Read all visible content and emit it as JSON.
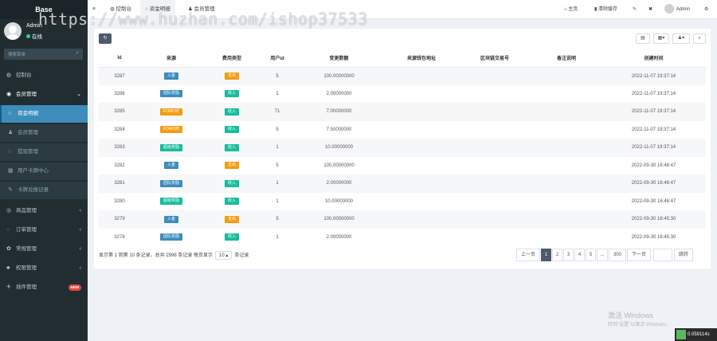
{
  "sidebar": {
    "brand": "Base",
    "user": {
      "name": "Admin",
      "status": "在线"
    },
    "search_placeholder": "搜索菜单",
    "items": [
      {
        "label": "控制台",
        "icon": "dashboard-icon",
        "type": "top"
      },
      {
        "label": "会员管理",
        "icon": "user-circle-icon",
        "type": "open",
        "arrow": "⌄"
      },
      {
        "label": "资金明细",
        "icon": "circle-icon",
        "type": "active"
      },
      {
        "label": "会员管理",
        "icon": "user-icon",
        "type": "sub"
      },
      {
        "label": "提现管理",
        "icon": "circle-icon",
        "type": "sub"
      },
      {
        "label": "用户卡牌中心",
        "icon": "table-icon",
        "type": "sub"
      },
      {
        "label": "卡牌兑换记录",
        "icon": "wrench-icon",
        "type": "sub"
      },
      {
        "label": "商品管理",
        "icon": "product-icon",
        "type": "top",
        "arrow": "‹"
      },
      {
        "label": "订单管理",
        "icon": "order-icon",
        "type": "top",
        "arrow": "‹"
      },
      {
        "label": "常规管理",
        "icon": "gear-icon",
        "type": "top",
        "arrow": "‹"
      },
      {
        "label": "权限管理",
        "icon": "group-icon",
        "type": "top",
        "arrow": "‹"
      },
      {
        "label": "插件管理",
        "icon": "rocket-icon",
        "type": "top",
        "badge": "NEW"
      }
    ]
  },
  "topbar": {
    "menu_icon": "≡",
    "tabs": [
      {
        "label": "控制台",
        "icon": "dashboard-icon"
      },
      {
        "label": "资金明细",
        "icon": "circle-icon"
      },
      {
        "label": "会员管理",
        "icon": "user-icon"
      }
    ],
    "home": "主页",
    "clear_cache": "清除缓存",
    "admin": "Admin"
  },
  "table": {
    "columns": [
      "Id",
      "来源",
      "费用类型",
      "用户id",
      "变更数额",
      "来源钱包地址",
      "区块链交易号",
      "备注说明",
      "创建时间"
    ],
    "rows": [
      [
        "3287",
        "入金",
        "支出",
        "5",
        "100.00000000",
        "",
        "",
        "",
        "2022-11-07 19:37:14"
      ],
      [
        "3286",
        "团队奖励",
        "收入",
        "1",
        "2.00000000",
        "",
        "",
        "",
        "2022-11-07 19:37:14"
      ],
      [
        "3285",
        "FOMO奖",
        "收入",
        "71",
        "7.00000000",
        "",
        "",
        "",
        "2022-11-07 19:37:14"
      ],
      [
        "3284",
        "FOMO奖",
        "收入",
        "5",
        "7.50000000",
        "",
        "",
        "",
        "2022-11-07 19:37:14"
      ],
      [
        "3283",
        "超级奖励",
        "收入",
        "1",
        "10.00000000",
        "",
        "",
        "",
        "2022-11-07 19:37:14"
      ],
      [
        "3282",
        "入金",
        "支出",
        "5",
        "100.00000000",
        "",
        "",
        "",
        "2022-09-30 16:46:47"
      ],
      [
        "3281",
        "团队奖励",
        "收入",
        "1",
        "2.00000000",
        "",
        "",
        "",
        "2022-09-30 16:46:47"
      ],
      [
        "3280",
        "超级奖励",
        "收入",
        "1",
        "10.00000000",
        "",
        "",
        "",
        "2022-09-30 16:46:47"
      ],
      [
        "3279",
        "入金",
        "支出",
        "5",
        "100.00000000",
        "",
        "",
        "",
        "2022-09-30 16:45:30"
      ],
      [
        "3278",
        "团队奖励",
        "收入",
        "1",
        "2.00000000",
        "",
        "",
        "",
        "2022-09-30 16:45:30"
      ]
    ]
  },
  "badge_colors": {
    "入金": "#3c8dbc",
    "团队奖励": "#3c8dbc",
    "FOMO奖": "#f39c12",
    "超级奖励": "#18bc9c",
    "支出": "#f39c12",
    "收入": "#18bc9c"
  },
  "pagination": {
    "summary_prefix": "显示第 1 到第 10 条记录，总共 2996 条记录 每页显示",
    "page_size": "10",
    "summary_suffix": "条记录",
    "prev": "上一页",
    "pages": [
      "1",
      "2",
      "3",
      "4",
      "5",
      "...",
      "300"
    ],
    "current": "1",
    "next": "下一页",
    "jump": "跳转"
  },
  "watermark": "https://www.huzhan.com/ishop37533",
  "windows": {
    "line1": "激活 Windows",
    "line2": "转到\"设置\"以激活 Windows。"
  },
  "timer": "0.059114s"
}
